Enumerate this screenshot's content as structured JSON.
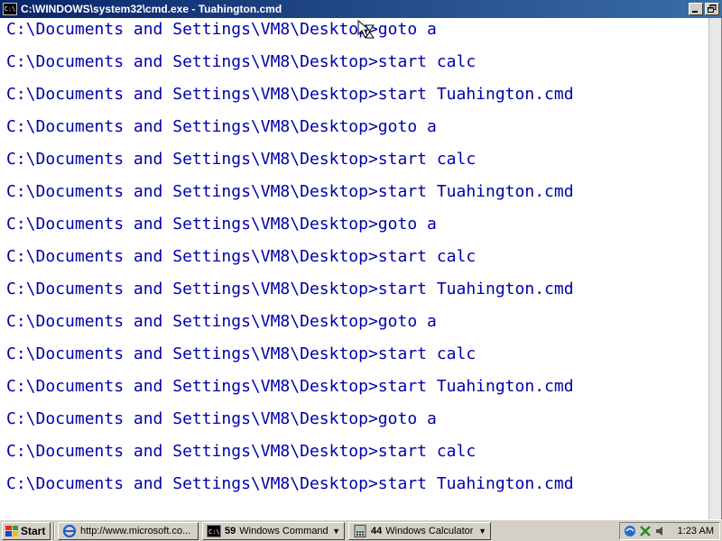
{
  "window": {
    "title": "C:\\WINDOWS\\system32\\cmd.exe - Tuahington.cmd",
    "icon_text": "C:\\"
  },
  "console_lines": [
    "C:\\Documents and Settings\\VM8\\Desktop>goto a",
    "C:\\Documents and Settings\\VM8\\Desktop>start calc",
    "C:\\Documents and Settings\\VM8\\Desktop>start Tuahington.cmd",
    "C:\\Documents and Settings\\VM8\\Desktop>goto a",
    "C:\\Documents and Settings\\VM8\\Desktop>start calc",
    "C:\\Documents and Settings\\VM8\\Desktop>start Tuahington.cmd",
    "C:\\Documents and Settings\\VM8\\Desktop>goto a",
    "C:\\Documents and Settings\\VM8\\Desktop>start calc",
    "C:\\Documents and Settings\\VM8\\Desktop>start Tuahington.cmd",
    "C:\\Documents and Settings\\VM8\\Desktop>goto a",
    "C:\\Documents and Settings\\VM8\\Desktop>start calc",
    "C:\\Documents and Settings\\VM8\\Desktop>start Tuahington.cmd",
    "C:\\Documents and Settings\\VM8\\Desktop>goto a",
    "C:\\Documents and Settings\\VM8\\Desktop>start calc",
    "C:\\Documents and Settings\\VM8\\Desktop>start Tuahington.cmd"
  ],
  "colors": {
    "console_text": "#0000a8",
    "titlebar_start": "#0a246a",
    "titlebar_end": "#3a6ea5"
  },
  "taskbar": {
    "start_label": "Start",
    "tasks": [
      {
        "count": "",
        "label": "http://www.microsoft.co...",
        "icon": "ie-icon"
      },
      {
        "count": "59",
        "label": "Windows Command ...",
        "icon": "cmd-icon"
      },
      {
        "count": "44",
        "label": "Windows Calculator",
        "icon": "calculator-icon"
      }
    ],
    "clock": "1:23 AM"
  }
}
